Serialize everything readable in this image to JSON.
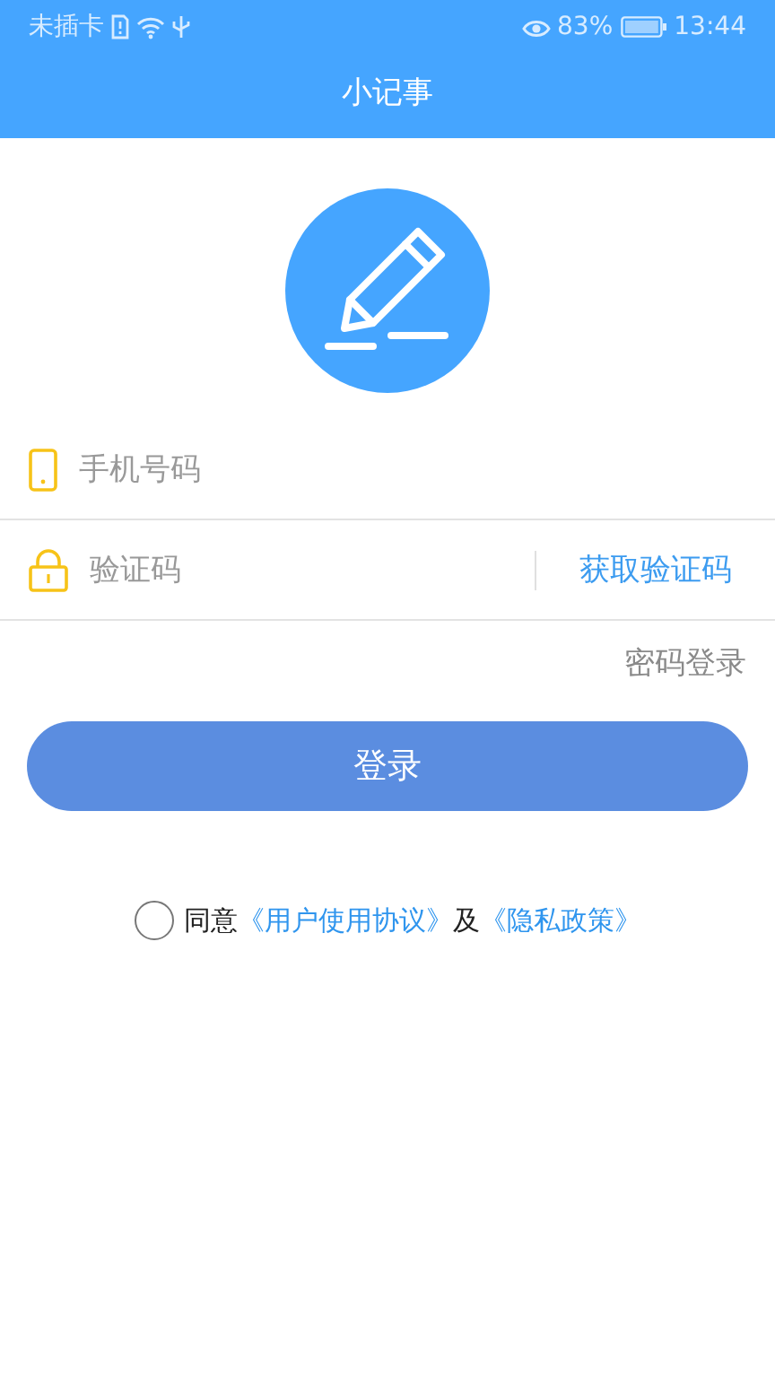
{
  "status_bar": {
    "carrier": "未插卡",
    "battery": "83%",
    "time": "13:44"
  },
  "header": {
    "title": "小记事"
  },
  "form": {
    "phone": {
      "placeholder": "手机号码"
    },
    "code": {
      "placeholder": "验证码"
    },
    "get_code": "获取验证码",
    "password_login": "密码登录"
  },
  "login_button": "登录",
  "agreement": {
    "checked": false,
    "prefix": "同意",
    "terms_link": "《用户使用协议》",
    "conjunction": "及",
    "privacy_link": "《隐私政策》"
  }
}
